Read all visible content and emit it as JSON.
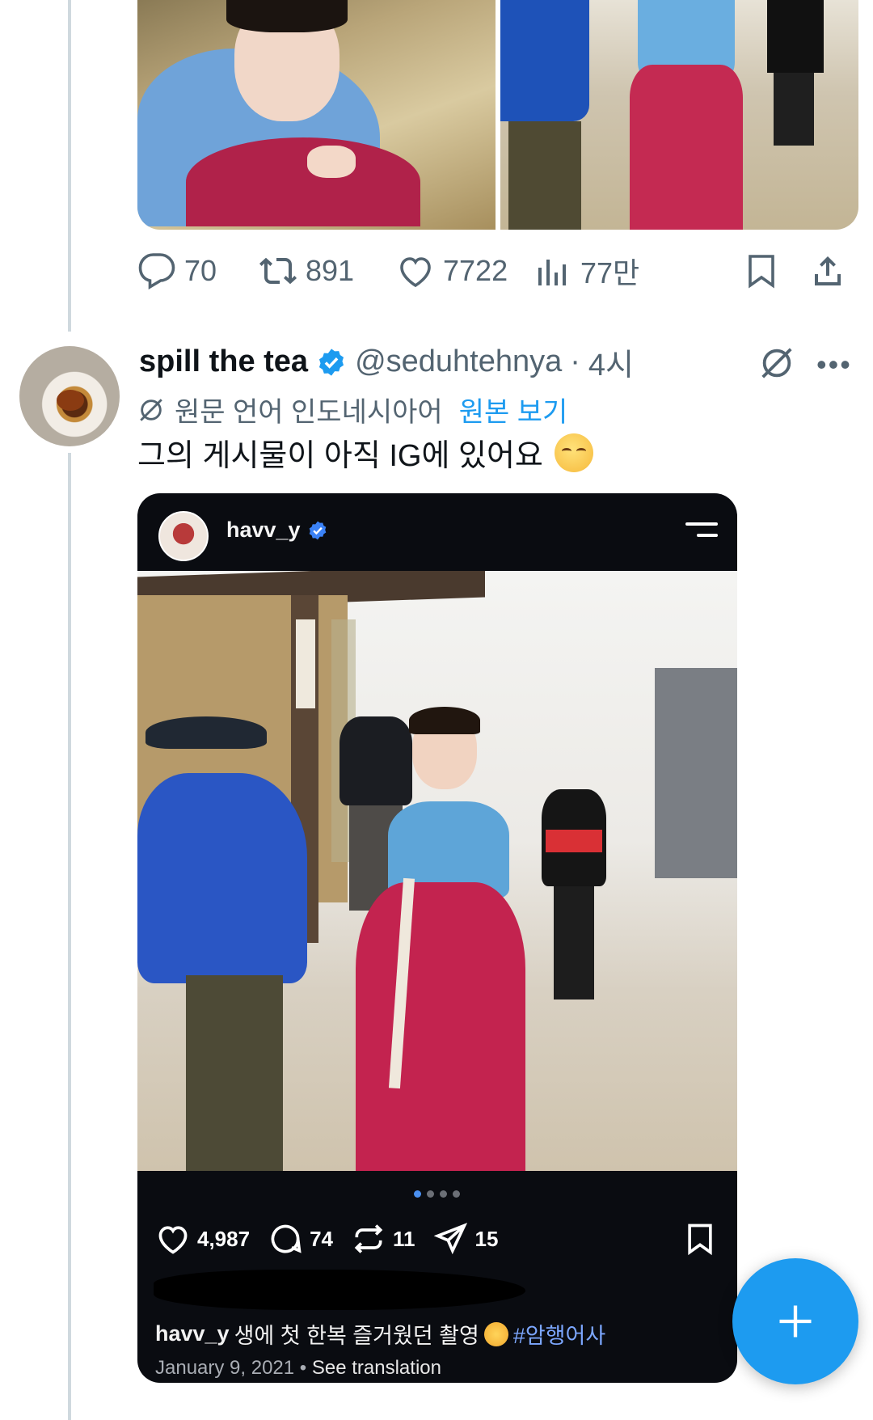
{
  "prev_tweet": {
    "images": [
      "photo-hanbok-sitting",
      "photo-hanbok-standing"
    ],
    "actions": {
      "replies": "70",
      "reposts": "891",
      "likes": "7722",
      "views": "77만"
    }
  },
  "tweet": {
    "display_name": "spill the tea",
    "handle": "@seduhtehnya",
    "time": "4시",
    "separator": "·",
    "translated_label": "원문 언어 인도네시아어",
    "show_original": "원본 보기",
    "text": "그의 게시물이 아직 IG에 있어요"
  },
  "instagram_post": {
    "username": "havv_y",
    "likes": "4,987",
    "comments": "74",
    "reposts": "11",
    "shares": "15",
    "caption_user": "havv_y",
    "caption_text": "생에 첫 한복 즐거웠던 촬영",
    "hashtag": "#암행어사",
    "date": "January 9, 2021",
    "meta_sep": "•",
    "see_translation": "See translation",
    "carousel_count": 4
  },
  "colors": {
    "accent": "#1d9bf0",
    "secondary_text": "#536471",
    "thread_line": "#cfd9de"
  },
  "icons": [
    "reply-icon",
    "repost-icon",
    "like-icon",
    "views-icon",
    "bookmark-icon",
    "share-icon",
    "verified-icon",
    "grok-icon",
    "more-icon",
    "compose-icon"
  ]
}
